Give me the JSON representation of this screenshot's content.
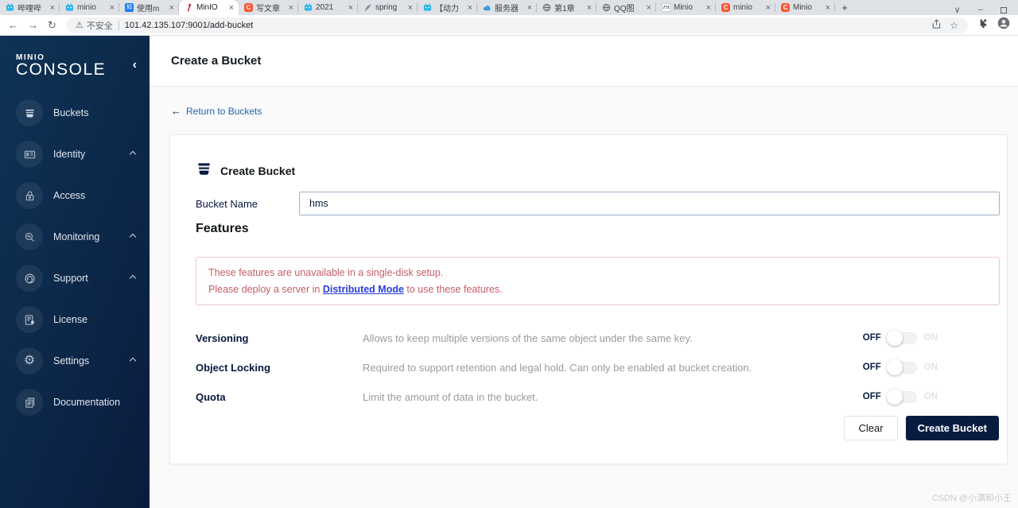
{
  "browser": {
    "tabs": [
      {
        "title": "哔哩哔",
        "icon": "bilibili-icon"
      },
      {
        "title": "minio",
        "icon": "bilibili-icon"
      },
      {
        "title": "使用m",
        "icon": "zhihu-icon"
      },
      {
        "title": "MinIO",
        "icon": "minio-flamingo-icon",
        "active": true
      },
      {
        "title": "写文章",
        "icon": "csdn-icon"
      },
      {
        "title": "2021",
        "icon": "bilibili-icon"
      },
      {
        "title": "spring",
        "icon": "pen-icon"
      },
      {
        "title": "【动力",
        "icon": "bilibili-icon"
      },
      {
        "title": "服务器",
        "icon": "cloud-icon"
      },
      {
        "title": "第1章",
        "icon": "globe-icon"
      },
      {
        "title": "QQ图",
        "icon": "globe-icon"
      },
      {
        "title": "Minio",
        "icon": "f8-icon"
      },
      {
        "title": "minio",
        "icon": "csdn-icon"
      },
      {
        "title": "Minio",
        "icon": "csdn-icon"
      }
    ],
    "tab_close": "×",
    "new_tab": "+",
    "controls": {
      "tab_search": "∨",
      "minimize": "−"
    },
    "nav": {
      "back": "←",
      "forward": "→",
      "reload": "↻"
    },
    "address": {
      "warning_glyph": "⚠",
      "security": "不安全",
      "url": "101.42.135.107:9001/add-bucket",
      "star": "☆"
    },
    "icon_glyphs": {
      "zhihu": "知",
      "csdn": "C",
      "f8": "F8",
      "gear": "⚙"
    }
  },
  "sidebar": {
    "logo_line1": "MINIO",
    "logo_line2": "CONSOLE",
    "collapse": "‹",
    "items": [
      {
        "label": "Buckets",
        "icon": "bucket-icon",
        "expandable": false
      },
      {
        "label": "Identity",
        "icon": "id-card-icon",
        "expandable": true
      },
      {
        "label": "Access",
        "icon": "lock-icon",
        "expandable": false
      },
      {
        "label": "Monitoring",
        "icon": "monitoring-icon",
        "expandable": true
      },
      {
        "label": "Support",
        "icon": "support-icon",
        "expandable": true
      },
      {
        "label": "License",
        "icon": "license-icon",
        "expandable": false
      },
      {
        "label": "Settings",
        "icon": "gear-icon",
        "expandable": true
      },
      {
        "label": "Documentation",
        "icon": "documentation-icon",
        "expandable": false
      }
    ]
  },
  "header": {
    "title": "Create a Bucket"
  },
  "main": {
    "back_arrow": "←",
    "back_link": "Return to Buckets",
    "form": {
      "section_title": "Create Bucket",
      "bucket_name_label": "Bucket Name",
      "bucket_name_value": "hms",
      "features_title": "Features",
      "warning_line1": "These features are unavailable in a single-disk setup.",
      "warning_line2_pre": "Please deploy a server in ",
      "warning_link": "Distributed Mode",
      "warning_line2_post": " to use these features.",
      "features": [
        {
          "label": "Versioning",
          "description": "Allows to keep multiple versions of the same object under the same key.",
          "state_off": "OFF",
          "state_on": "ON"
        },
        {
          "label": "Object Locking",
          "description": "Required to support retention and legal hold. Can only be enabled at bucket creation.",
          "state_off": "OFF",
          "state_on": "ON"
        },
        {
          "label": "Quota",
          "description": "Limit the amount of data in the bucket.",
          "state_off": "OFF",
          "state_on": "ON"
        }
      ],
      "clear_button": "Clear",
      "create_button": "Create Bucket"
    }
  },
  "watermark": "CSDN @小满和小王",
  "colors": {
    "sidebar_navy": "#0a1c3d",
    "accent_navy": "#081C42",
    "link_blue": "#2064a8",
    "warn_red": "#c25e68",
    "warn_link_blue": "#2b3cdb"
  }
}
